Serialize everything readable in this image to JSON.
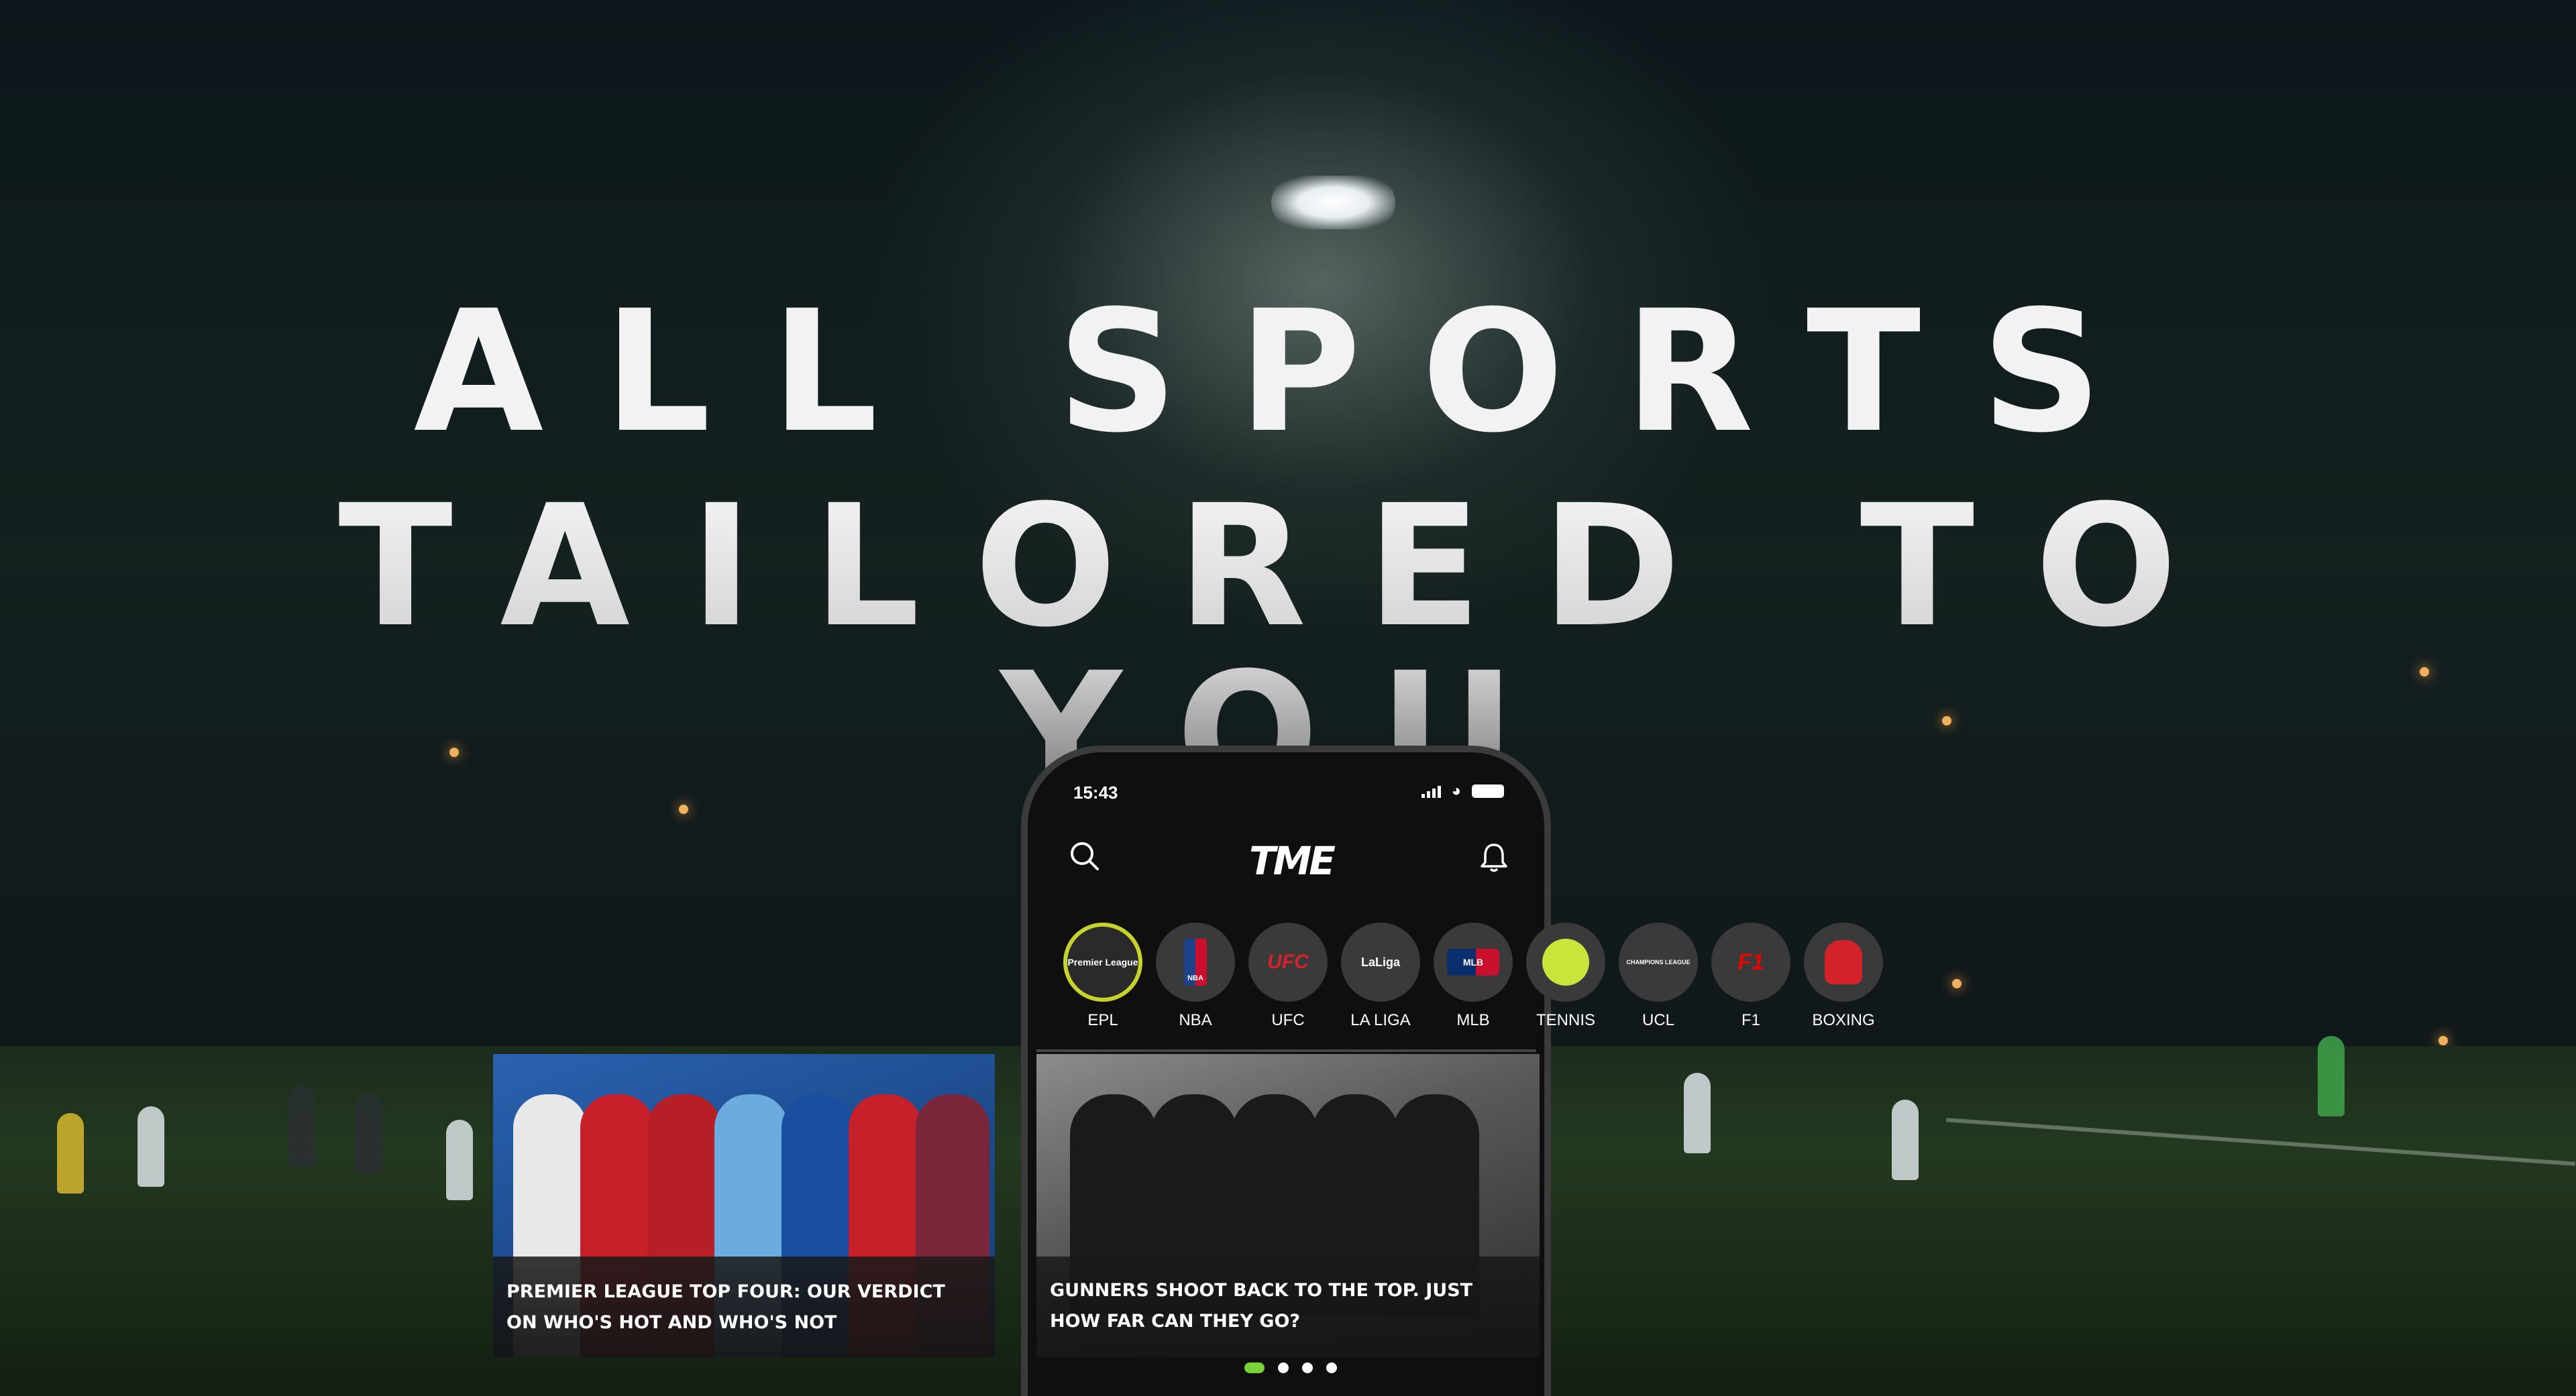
{
  "headline": {
    "line1": "ALL SPORTS",
    "line2": "TAILORED TO YOU"
  },
  "phone": {
    "status_time": "15:43",
    "logo": "TME",
    "search_icon": "search-icon",
    "bell_icon": "bell-icon",
    "leagues": [
      {
        "label": "EPL",
        "badge": "Premier League",
        "active": true
      },
      {
        "label": "NBA",
        "badge": "NBA"
      },
      {
        "label": "UFC",
        "badge": "UFC"
      },
      {
        "label": "LA LIGA",
        "badge": "LaLiga"
      },
      {
        "label": "MLB",
        "badge": "MLB"
      },
      {
        "label": "TENNIS",
        "badge": ""
      },
      {
        "label": "UCL",
        "badge": "CHAMPIONS LEAGUE"
      },
      {
        "label": "F1",
        "badge": "F1"
      },
      {
        "label": "BOXING",
        "badge": ""
      }
    ],
    "main_article": {
      "title_line1": "GUNNERS SHOOT BACK TO THE TOP. JUST",
      "title_line2": "HOW FAR CAN THEY GO?"
    },
    "pagination": {
      "total": 4,
      "active": 1
    }
  },
  "side_article": {
    "title_line1": "PREMIER LEAGUE TOP FOUR: OUR VERDICT",
    "title_line2": "ON WHO'S HOT AND WHO'S NOT"
  },
  "colors": {
    "accent_green": "#7bd13a",
    "epl_ring": "#c7d22c",
    "ufc_red": "#d3222a",
    "f1_red": "#e10600"
  }
}
